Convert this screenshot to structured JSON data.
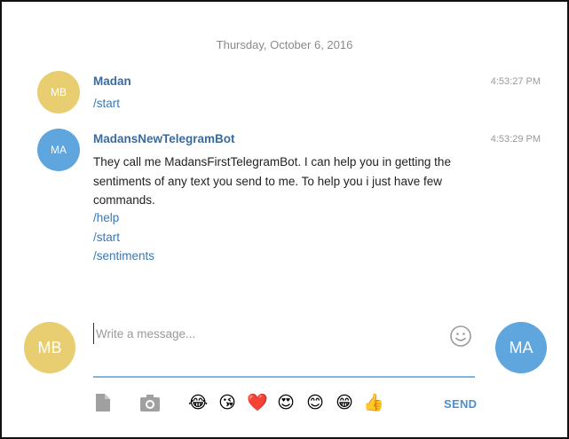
{
  "chat": {
    "date": "Thursday, October 6, 2016",
    "messages": [
      {
        "avatar": "MB",
        "sender": "Madan",
        "time": "4:53:27 PM",
        "command": "/start"
      },
      {
        "avatar": "MA",
        "sender": "MadansNewTelegramBot",
        "time": "4:53:29 PM",
        "text": "They call me MadansFirstTelegramBot. I can help you in getting the sentiments of any text you send to me. To help you i just have few commands.",
        "commands": [
          "/help",
          "/start",
          "/sentiments"
        ]
      }
    ]
  },
  "composer": {
    "left_avatar": "MB",
    "right_avatar": "MA",
    "placeholder": "Write a message...",
    "send_label": "SEND",
    "emoji_icon": "smile-icon",
    "tools": [
      "file-icon",
      "camera-icon"
    ],
    "emojis": [
      "😂",
      "😘",
      "❤️",
      "😍",
      "😊",
      "😁",
      "👍"
    ]
  },
  "colors": {
    "avatar_mb": "#e9cd71",
    "avatar_ma": "#5fa5de",
    "link": "#3a78b4",
    "send": "#4a90d0"
  }
}
